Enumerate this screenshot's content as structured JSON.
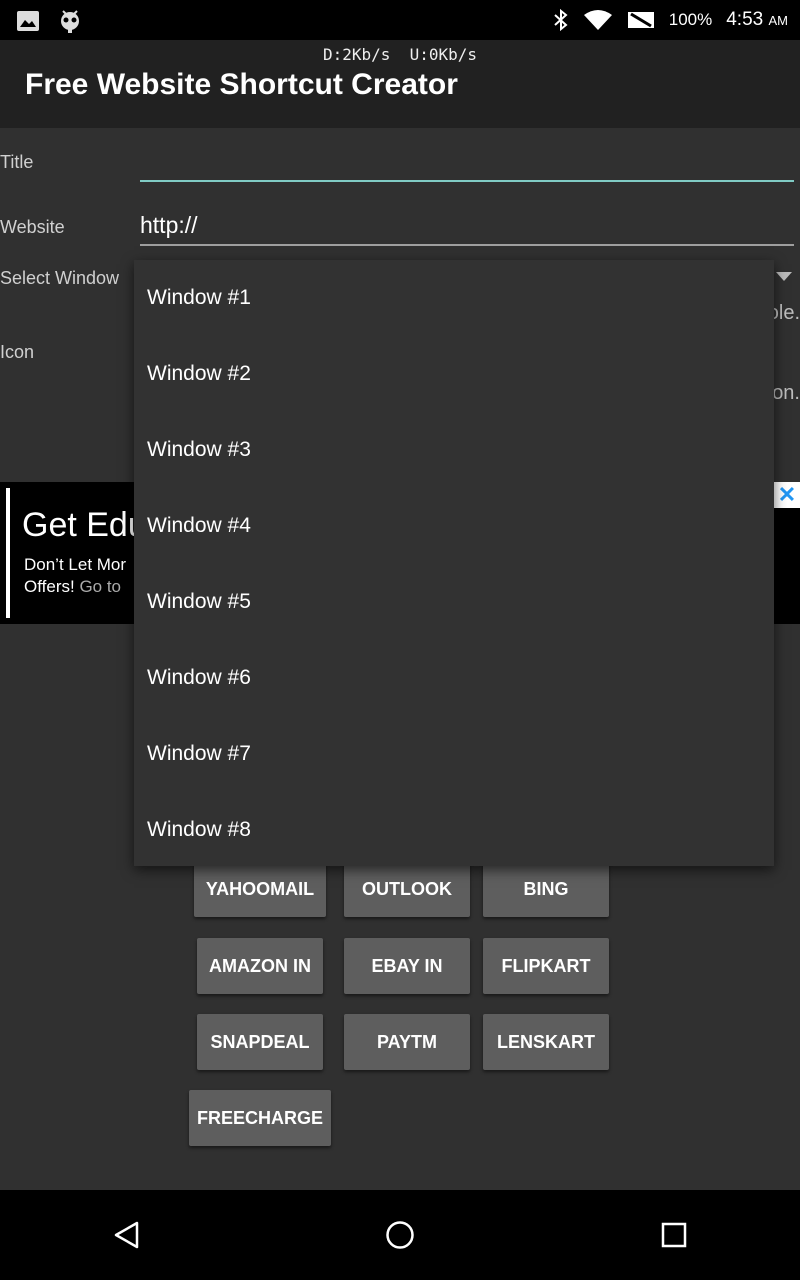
{
  "status_bar": {
    "battery": "100%",
    "time": "4:53",
    "ampm": "AM",
    "icons": [
      "image-icon",
      "android-debug-icon",
      "bluetooth-icon",
      "wifi-icon",
      "no-sim-icon"
    ]
  },
  "action_bar": {
    "net_speed": "D:2Kb/s  U:0Kb/s",
    "title": "Free Website Shortcut Creator"
  },
  "form": {
    "title_label": "Title",
    "title_value": "",
    "website_label": "Website",
    "website_value": "http://",
    "window_label": "Select Window",
    "icon_label": "Icon",
    "peek_text_1": "ole.",
    "peek_text_2": "on."
  },
  "ad": {
    "headline": "Get Edu",
    "body_line1": "Don’t Let Mor",
    "body_line2": "Offers!",
    "body_link": "Go to",
    "close": "✕"
  },
  "shortcuts": {
    "yahoomail": "YAHOOMAIL",
    "outlook": "OUTLOOK",
    "bing": "BING",
    "amazon_in": "AMAZON IN",
    "ebay_in": "EBAY IN",
    "flipkart": "FLIPKART",
    "snapdeal": "SNAPDEAL",
    "paytm": "PAYTM",
    "lenskart": "LENSKART",
    "freecharge": "FREECHARGE"
  },
  "dropdown": {
    "items": [
      "Window #1",
      "Window #2",
      "Window #3",
      "Window #4",
      "Window #5",
      "Window #6",
      "Window #7",
      "Window #8"
    ]
  },
  "colors": {
    "accent": "#80cbc4",
    "background": "#303030",
    "button": "#5e5e5e"
  }
}
